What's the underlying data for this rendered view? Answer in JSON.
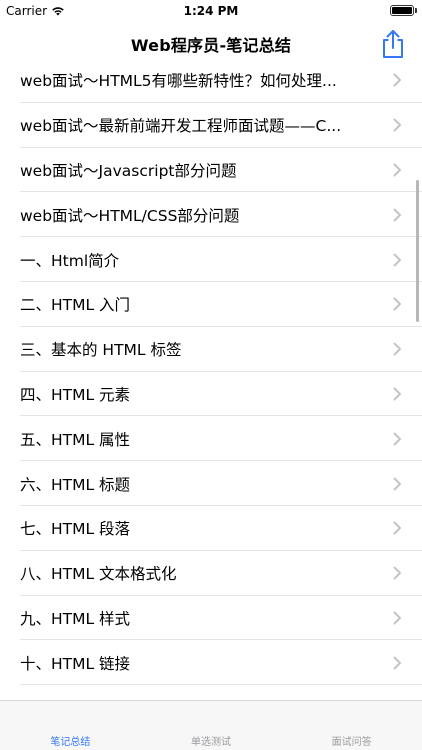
{
  "status_bar": {
    "carrier": "Carrier",
    "time": "1:24 PM"
  },
  "nav": {
    "title": "Web程序员-笔记总结",
    "share_icon": "share-icon",
    "accent": "#3478f6"
  },
  "list": {
    "items": [
      {
        "label": "web面试～HTML5有哪些新特性？如何处理..."
      },
      {
        "label": "web面试～最新前端开发工程师面试题——C..."
      },
      {
        "label": "web面试～Javascript部分问题"
      },
      {
        "label": "web面试～HTML/CSS部分问题"
      },
      {
        "label": "一、Html简介"
      },
      {
        "label": "二、HTML 入门"
      },
      {
        "label": "三、基本的 HTML 标签"
      },
      {
        "label": "四、HTML 元素"
      },
      {
        "label": "五、HTML 属性"
      },
      {
        "label": "六、HTML 标题"
      },
      {
        "label": "七、HTML 段落"
      },
      {
        "label": "八、HTML 文本格式化"
      },
      {
        "label": "九、HTML 样式"
      },
      {
        "label": "十、HTML 链接"
      }
    ]
  },
  "tab_bar": {
    "tabs": [
      {
        "label": "笔记总结",
        "active": true
      },
      {
        "label": "单选测试",
        "active": false
      },
      {
        "label": "面试问答",
        "active": false
      }
    ]
  }
}
